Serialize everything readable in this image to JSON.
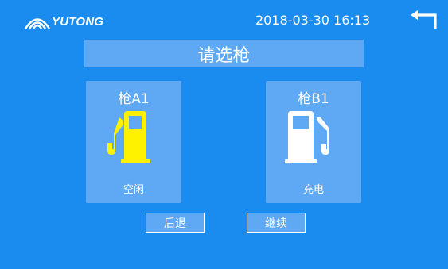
{
  "header": {
    "logo_text": "YUTONG",
    "datetime": "2018-03-30 16:13",
    "back_icon": "return-arrow-icon"
  },
  "title": "请选枪",
  "guns": [
    {
      "name": "枪A1",
      "status": "空闲",
      "icon": "fuel-pump-icon",
      "icon_color": "#fff200"
    },
    {
      "name": "枪B1",
      "status": "充电",
      "icon": "fuel-pump-icon",
      "icon_color": "#ffffff"
    }
  ],
  "buttons": {
    "back_label": "后退",
    "continue_label": "继续"
  },
  "colors": {
    "background": "#1a8cf0",
    "panel": "#5ea8f4",
    "idle_accent": "#fff200"
  }
}
